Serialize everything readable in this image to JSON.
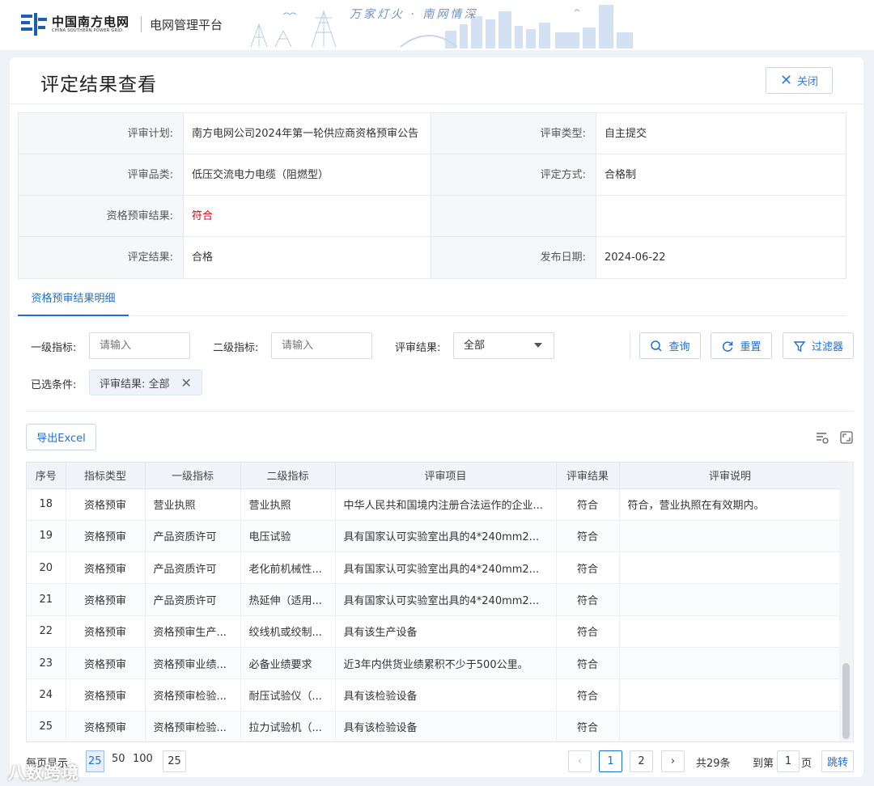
{
  "header": {
    "org_name": "中国南方电网",
    "org_name_en": "CHINA SOUTHERN POWER GRID",
    "platform": "电网管理平台",
    "slogan": "万家灯火 · 南网情深"
  },
  "page": {
    "title": "评定结果查看",
    "close_label": "关闭"
  },
  "info": {
    "plan_label": "评审计划:",
    "plan_value": "南方电网公司2024年第一轮供应商资格预审公告",
    "review_type_label": "评审类型:",
    "review_type_value": "自主提交",
    "category_label": "评审品类:",
    "category_value": "低压交流电力电缆（阻燃型）",
    "method_label": "评定方式:",
    "method_value": "合格制",
    "prequal_label": "资格预审结果:",
    "prequal_value": "符合",
    "result_label": "评定结果:",
    "result_value": "合格",
    "date_label": "发布日期:",
    "date_value": "2024-06-22"
  },
  "tabs": {
    "active": "资格预审结果明细"
  },
  "filters": {
    "level1_label": "一级指标:",
    "level1_placeholder": "请输入",
    "level2_label": "二级指标:",
    "level2_placeholder": "请输入",
    "result_label": "评审结果:",
    "result_value": "全部",
    "query_label": "查询",
    "reset_label": "重置",
    "filter_label": "过滤器",
    "selected_label": "已选条件:",
    "chip_label": "评审结果: 全部"
  },
  "toolbar": {
    "export_label": "导出Excel"
  },
  "table": {
    "columns": [
      "序号",
      "指标类型",
      "一级指标",
      "二级指标",
      "评审项目",
      "评审结果",
      "评审说明"
    ],
    "rows": [
      [
        "18",
        "资格预审",
        "营业执照",
        "营业执照",
        "中华人民共和国境内注册合法运作的企业...",
        "符合",
        "符合，营业执照在有效期内。"
      ],
      [
        "19",
        "资格预审",
        "产品资质许可",
        "电压试验",
        "具有国家认可实验室出具的4*240mm2...",
        "符合",
        ""
      ],
      [
        "20",
        "资格预审",
        "产品资质许可",
        "老化前机械性...",
        "具有国家认可实验室出具的4*240mm2...",
        "符合",
        ""
      ],
      [
        "21",
        "资格预审",
        "产品资质许可",
        "热延伸（适用...",
        "具有国家认可实验室出具的4*240mm2...",
        "符合",
        ""
      ],
      [
        "22",
        "资格预审",
        "资格预审生产...",
        "绞线机或绞制...",
        "具有该生产设备",
        "符合",
        ""
      ],
      [
        "23",
        "资格预审",
        "资格预审业绩...",
        "必备业绩要求",
        "近3年内供货业绩累积不少于500公里。",
        "符合",
        ""
      ],
      [
        "24",
        "资格预审",
        "资格预审检验...",
        "耐压试验仪（...",
        "具有该检验设备",
        "符合",
        ""
      ],
      [
        "25",
        "资格预审",
        "资格预审检验...",
        "拉力试验机（...",
        "具有该检验设备",
        "符合",
        ""
      ]
    ]
  },
  "pagination": {
    "page_size_label": "每页显示",
    "sizes": [
      "25",
      "50",
      "100"
    ],
    "current_size": "25",
    "prev": "‹",
    "next": "›",
    "pages": [
      "1",
      "2"
    ],
    "total": "共29条",
    "goto_label": "到第",
    "goto_value": "1",
    "page_unit": "页",
    "jump_label": "跳转"
  },
  "watermark": "八数跨境",
  "colors": {
    "primary": "#1f6fd0",
    "danger": "#d9001b",
    "header_bg": "#f1f4f8"
  }
}
